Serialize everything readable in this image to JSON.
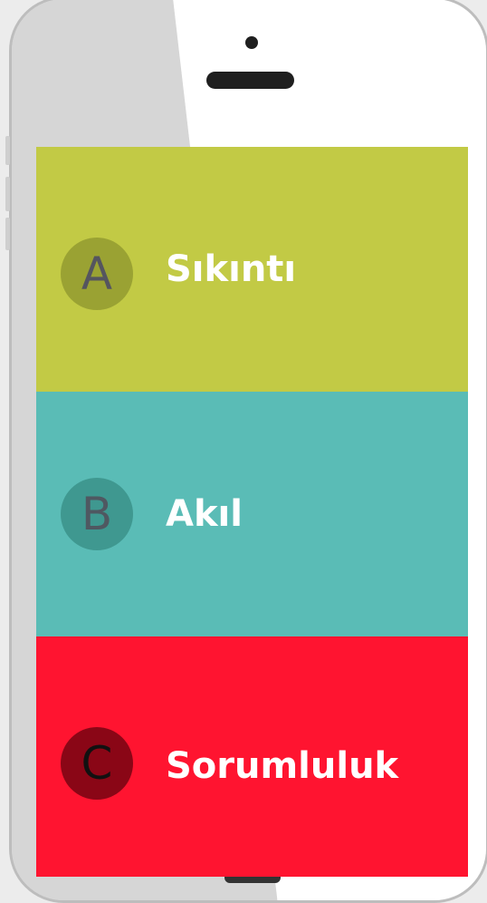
{
  "options": [
    {
      "letter": "A",
      "label": "Sıkıntı"
    },
    {
      "letter": "B",
      "label": "Akıl"
    },
    {
      "letter": "C",
      "label": "Sorumluluk"
    }
  ],
  "colors": {
    "option_a": "#c2ca45",
    "option_b": "#5abcb6",
    "option_c": "#ff1430",
    "label_text": "#ffffff"
  }
}
